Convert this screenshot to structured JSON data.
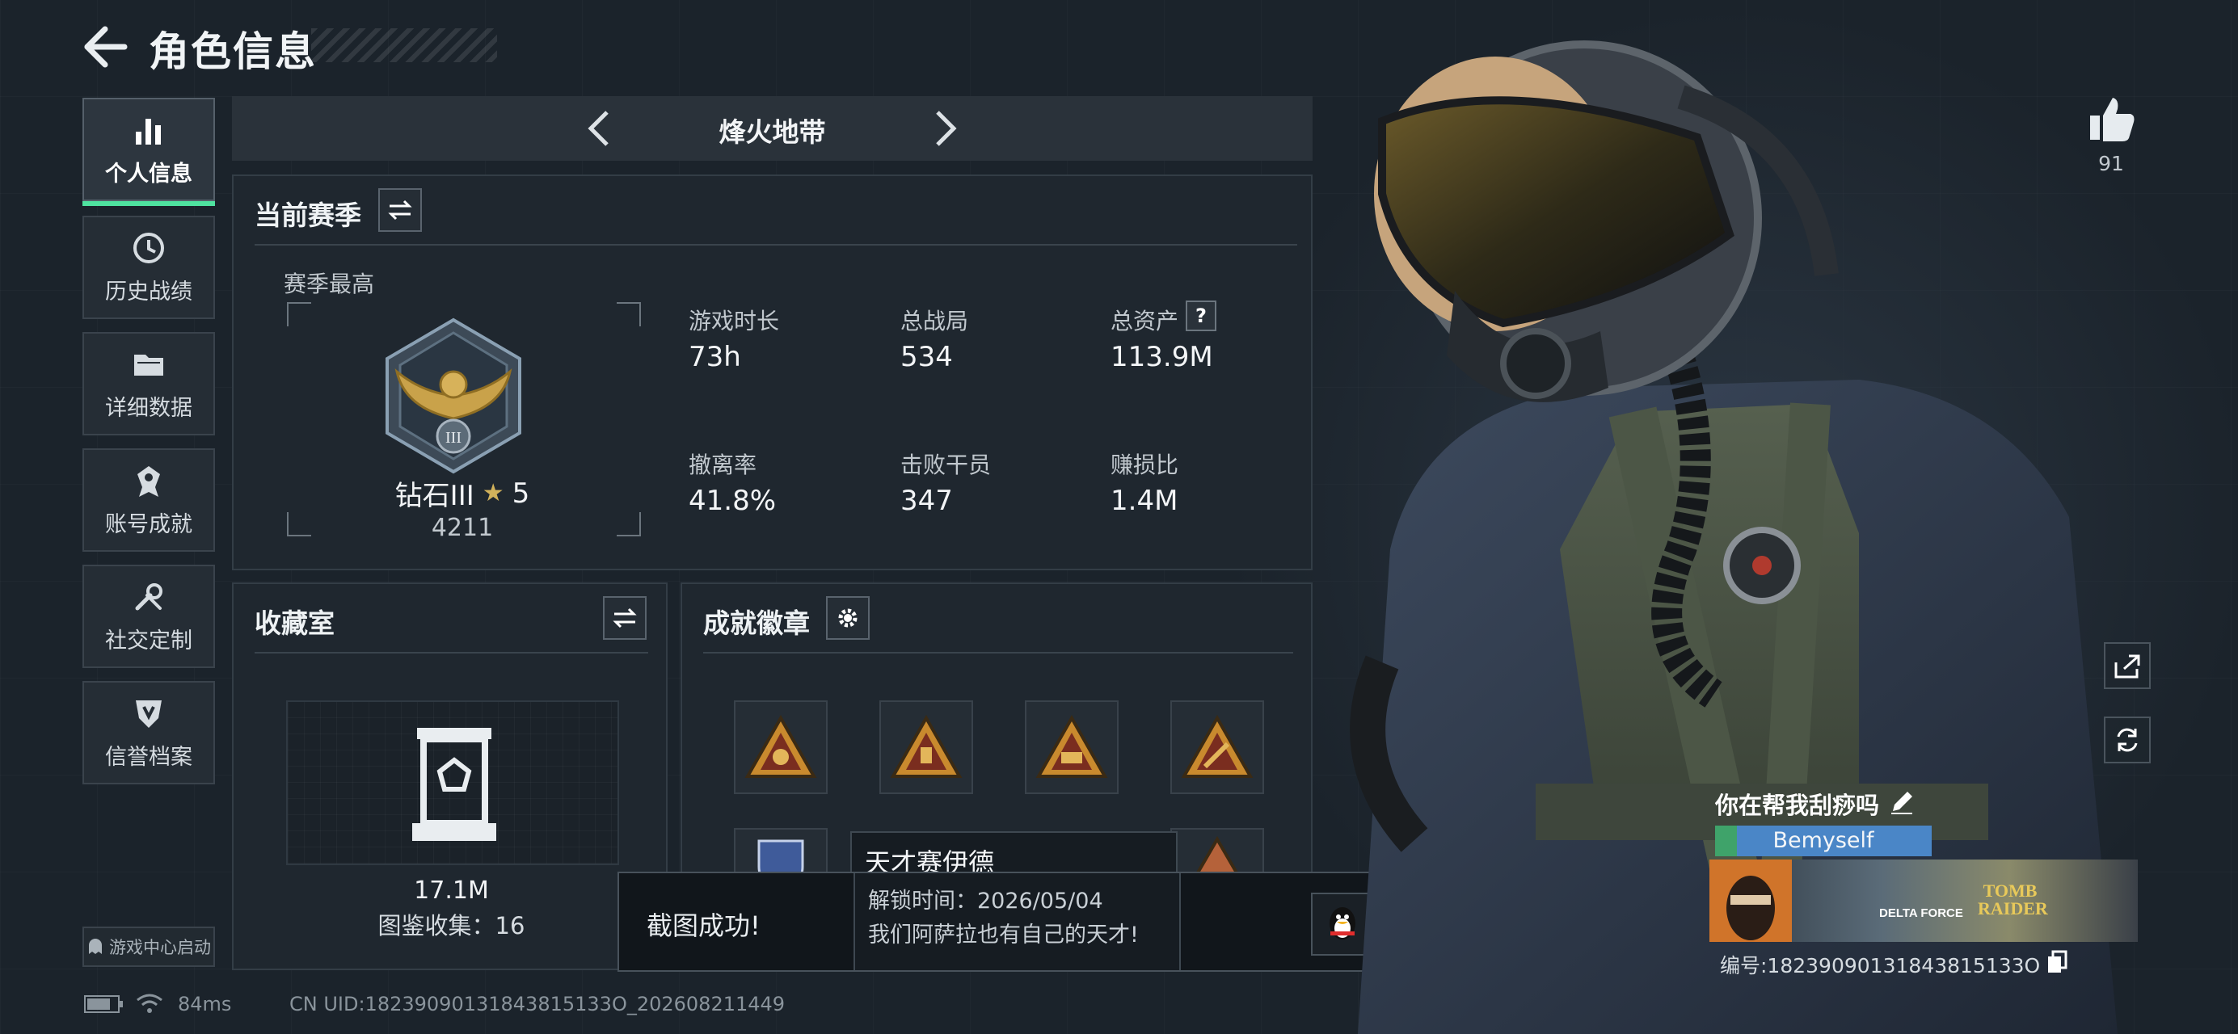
{
  "header": {
    "title": "角色信息"
  },
  "nav": {
    "items": [
      {
        "label": "个人信息",
        "icon": "bar-chart-icon",
        "active": true
      },
      {
        "label": "历史战绩",
        "icon": "clock-icon"
      },
      {
        "label": "详细数据",
        "icon": "folder-icon"
      },
      {
        "label": "账号成就",
        "icon": "medal-icon"
      },
      {
        "label": "社交定制",
        "icon": "wrench-icon"
      },
      {
        "label": "信誉档案",
        "icon": "shield-icon"
      }
    ],
    "game_center": "游戏中心启动"
  },
  "mode": {
    "title": "烽火地带"
  },
  "season": {
    "title": "当前赛季",
    "best_label": "赛季最高",
    "rank_name": "钻石III",
    "rank_stars": "5",
    "rank_score": "4211",
    "stats": [
      {
        "label": "游戏时长",
        "value": "73h"
      },
      {
        "label": "总战局",
        "value": "534"
      },
      {
        "label": "总资产",
        "value": "113.9M"
      },
      {
        "label": "撤离率",
        "value": "41.8%"
      },
      {
        "label": "击败干员",
        "value": "347"
      },
      {
        "label": "赚损比",
        "value": "1.4M"
      }
    ],
    "help_symbol": "?"
  },
  "collection": {
    "title": "收藏室",
    "value": "17.1M",
    "count_text": "图鉴收集：16"
  },
  "badges": {
    "title": "成就徽章"
  },
  "tooltip": {
    "name": "天才赛伊德",
    "unlock": "解锁时间：2026/05/04",
    "desc": "我们阿萨拉也有自己的天才!"
  },
  "toast": {
    "text": "截图成功!"
  },
  "profile": {
    "likes": "91",
    "nickname": "你在帮我刮痧吗",
    "tag": "Bemyself",
    "uid_label": "编号:18239090131843815133O",
    "banner_logo_1": "DELTA FORCE",
    "banner_logo_2": "TOMB RAIDER"
  },
  "status_bar": {
    "ping": "84ms",
    "uid": "CN UID:18239090131843815133O_202608211449"
  },
  "colors": {
    "accent": "#4fe3a0",
    "background": "#1b232b",
    "tag_bg": "#4a86c7"
  }
}
